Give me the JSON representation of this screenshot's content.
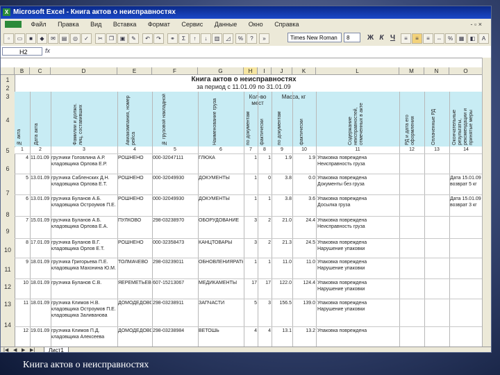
{
  "window": {
    "title": "Microsoft Excel - Книга актов о неисправностях",
    "menu": [
      "Файл",
      "Правка",
      "Вид",
      "Вставка",
      "Формат",
      "Сервис",
      "Данные",
      "Окно",
      "Справка"
    ],
    "menu_right": "- ▫ ×"
  },
  "toolbar": {
    "font_name": "Times New Roman",
    "font_size": "8",
    "bold": "Ж",
    "italic": "К",
    "underline": "Ч"
  },
  "formula_bar": {
    "name_box": "Н2",
    "fx": "fx"
  },
  "columns": [
    "B",
    "C",
    "D",
    "E",
    "F",
    "G",
    "H",
    "I",
    "J",
    "K",
    "L",
    "M",
    "N",
    "O",
    "P"
  ],
  "rows_visible": [
    "1",
    "2",
    "3",
    "4",
    "5",
    "6",
    "7",
    "8",
    "9",
    "10",
    "11",
    "12",
    "13",
    "14",
    "15"
  ],
  "sheet": {
    "title": "Книга актов о неисправностях",
    "subtitle": "за период с 11.01.09 по 31.01.09",
    "group_qty": "Кол-во мест",
    "group_mass": "Масса, кг",
    "headers_vertical": [
      "№ акта",
      "Дата акта",
      "Фамилии и должн. лиц, составивших",
      "Авиакомпания, номер рейса",
      "№ грузовой накладной",
      "Наименование груза",
      "по документам",
      "фактически",
      "по документам",
      "фактически",
      "Содержание неисправностей, отмеченных в акте",
      "РД и дата его оформления",
      "Оплаченные РД",
      "Окончательные результаты, рекомендации и принятые меры"
    ],
    "col_numbers": [
      "1",
      "2",
      "3",
      "4",
      "5",
      "6",
      "7",
      "8",
      "9",
      "10",
      "11",
      "12",
      "13",
      "14"
    ]
  },
  "data_rows": [
    {
      "n": "4",
      "date": "11.01.09",
      "persons": "грузчики Головлина А.Р.; кладовщика Орлова Е.Р.",
      "airline": "РОШНЕНО",
      "awb": "000-32047111",
      "name": "ГЛЮКА",
      "qd": "1",
      "qf": "1",
      "md": "1.9",
      "mf": "1.9",
      "defect": "Упаковка повреждена; Неисправность груза",
      "rd": "",
      "paid": "",
      "result": ""
    },
    {
      "n": "5",
      "date": "13.01.09",
      "persons": "грузчика Сабленских Д.Н.; кладовщика Орлова Е.Т.",
      "airline": "РОШНЕНО",
      "awb": "000-32049930",
      "name": "ДОКУМЕНТЫ",
      "qd": "1",
      "qf": "0",
      "md": "3.8",
      "mf": "0.0",
      "defect": "Упаковка повреждена; Документы без груза",
      "rd": "",
      "paid": "",
      "result": "Дата 15.01.09; возврат 5 кг"
    },
    {
      "n": "6",
      "date": "13.01.09",
      "persons": "грузчика Буланов А.Б.; кладовщика Остроумов П.Е.",
      "airline": "РОШНЕНО",
      "awb": "000-32049930",
      "name": "ДОКУМЕНТЫ",
      "qd": "1",
      "qf": "1",
      "md": "3.8",
      "mf": "3.6",
      "defect": "Упаковка повреждена; Досылка груза",
      "rd": "",
      "paid": "",
      "result": "Дата 15.01.09; возврат 3 кг"
    },
    {
      "n": "7",
      "date": "15.01.09",
      "persons": "грузчика Буланов А.Б.; кладовщика Орлова Е.А.",
      "airline": "ПУЛКОВО",
      "awb": "298-03238970",
      "name": "ОБОРУДОВАНИЕ",
      "qd": "3",
      "qf": "2",
      "md": "21.0",
      "mf": "24.4",
      "defect": "Упаковка повреждена; Неисправность груза",
      "rd": "",
      "paid": "",
      "result": ""
    },
    {
      "n": "8",
      "date": "17.01.09",
      "persons": "грузчика Буланов В.Г.; кладовщика Орлов Е.Т.",
      "airline": "РОШНЕНО",
      "awb": "000-32358473",
      "name": "КАНЦТОВАРЫ",
      "qd": "3",
      "qf": "2",
      "md": "21.3",
      "mf": "24.5",
      "defect": "Упаковка повреждена; Нарушение упаковки",
      "rd": "",
      "paid": "",
      "result": ""
    },
    {
      "n": "9",
      "date": "18.01.09",
      "persons": "грузчика Григорьева П.Е.; кладовщика Махонина Ю.М.",
      "airline": "ТОЛМАЧЕВО",
      "awb": "298-03239011",
      "name": "ОБНОВЛЕНИЯРАТЫ",
      "qd": "1",
      "qf": "1",
      "md": "11.0",
      "mf": "11.0",
      "defect": "Упаковка повреждена; Нарушение упаковки",
      "rd": "",
      "paid": "",
      "result": ""
    },
    {
      "n": "10",
      "date": "18.01.09",
      "persons": "грузчика Буланов С.В.",
      "airline": "ЯЕРЕМЕТЬЕВО",
      "awb": "607-15213067",
      "name": "МЕДИКАМЕНТЫ",
      "qd": "17",
      "qf": "17",
      "md": "122.0",
      "mf": "124.4",
      "defect": "Упаковка повреждена; Нарушение упаковки",
      "rd": "",
      "paid": "",
      "result": ""
    },
    {
      "n": "11",
      "date": "18.01.09",
      "persons": "грузчика Климов Н.В.; кладовщика Остроумов П.Е.; кладовщика Заливанова К.А.",
      "airline": "ДОМОДЕДОВО",
      "awb": "298-03238911",
      "name": "ЗАПЧАСТИ",
      "qd": "5",
      "qf": "3",
      "md": "156.5",
      "mf": "139.0",
      "defect": "Упаковка повреждена; Нарушение упаковки",
      "rd": "",
      "paid": "",
      "result": ""
    },
    {
      "n": "12",
      "date": "19.01.09",
      "persons": "грузчика Климов П.Д.; кладовщика Алексеева",
      "airline": "ДОМОДЕДОВО",
      "awb": "298-03238984",
      "name": "ВЕТОШЬ",
      "qd": "4",
      "qf": "4",
      "md": "13.1",
      "mf": "13.2",
      "defect": "Упаковка повреждена",
      "rd": "",
      "paid": "",
      "result": ""
    }
  ],
  "sheet_tab": "Лист1",
  "caption": "Книга актов о неисправностях"
}
